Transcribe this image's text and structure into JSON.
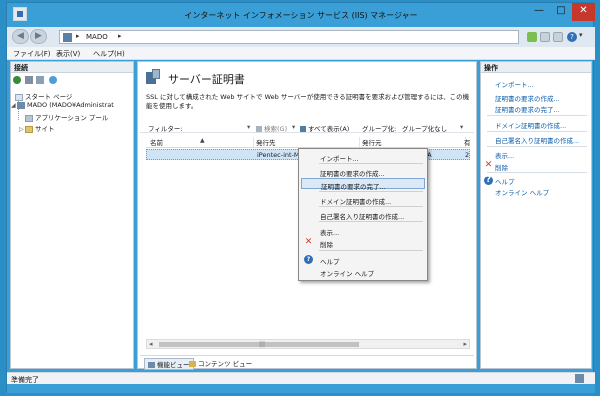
{
  "window": {
    "title": "インターネット インフォメーション サービス (IIS) マネージャー",
    "min_glyph": "—",
    "max_glyph": "□",
    "close_glyph": "✕"
  },
  "nav": {
    "back_glyph": "◀",
    "fwd_glyph": "▶",
    "sep1": "▸",
    "address_segment": "MADO",
    "sep2": "▸",
    "help_glyph": "?",
    "help_dropdown": "▾"
  },
  "menu": [
    "ファイル(F)",
    "表示(V)",
    "ヘルプ(H)"
  ],
  "connections": {
    "header": "接続",
    "tree": [
      {
        "label": "スタート ページ",
        "icon": "start-page-icon"
      },
      {
        "label": "MADO (MADO¥Administrat",
        "icon": "server-icon",
        "expander": "◢"
      },
      {
        "label": "アプリケーション プール",
        "icon": "app-pool-icon"
      },
      {
        "label": "サイト",
        "icon": "sites-icon",
        "expander": "▷"
      }
    ]
  },
  "main": {
    "title": "サーバー証明書",
    "description": "SSL に対して構成された Web サイトで Web サーバーが使用できる証明書を要求および管理するには、この機能を使用します。",
    "filter_label": "フィルター:",
    "filter_dropdown": "▾",
    "search_label": "検索(G)",
    "search_dropdown": "▾",
    "show_all_label": "すべて表示(A)",
    "group_label": "グループ化:",
    "group_value": "グループ化なし",
    "group_dropdown": "▾",
    "columns": [
      "名前",
      "発行先",
      "発行元",
      "有"
    ],
    "sort_glyph": "▲",
    "rows": [
      {
        "name": "",
        "issued_to": "iPentec-int-MADO-CA",
        "issued_by": "iPentec-int-MADO-CA",
        "expires": "2"
      }
    ],
    "scroll_left": "◂",
    "scroll_right": "▸",
    "scroll_grip": "|||",
    "tabs": [
      "機能ビュー",
      "コンテンツ ビュー"
    ]
  },
  "context_menu": {
    "items": [
      {
        "label": "インポート..."
      },
      {
        "label": "証明書の要求の作成..."
      },
      {
        "label": "証明書の要求の完了...",
        "highlighted": true
      },
      {
        "label": "ドメイン証明書の作成..."
      },
      {
        "label": "自己署名入り証明書の作成..."
      },
      {
        "label": "表示..."
      },
      {
        "label": "削除",
        "icon": "delete-icon",
        "glyph": "✕"
      },
      {
        "label": "ヘルプ",
        "icon": "help-icon",
        "glyph": "?"
      },
      {
        "label": "オンライン ヘルプ"
      }
    ]
  },
  "actions": {
    "header": "操作",
    "items": [
      {
        "label": "インポート..."
      },
      {
        "label": "証明書の要求の作成..."
      },
      {
        "label": "証明書の要求の完了..."
      },
      {
        "label": "ドメイン証明書の作成..."
      },
      {
        "label": "自己署名入り証明書の作成..."
      },
      {
        "label": "表示..."
      },
      {
        "label": "削除",
        "glyph": "✕"
      },
      {
        "label": "ヘルプ",
        "glyph": "?"
      },
      {
        "label": "オンライン ヘルプ"
      }
    ]
  },
  "status": {
    "text": "準備完了"
  },
  "colors": {
    "accent": "#3a9fd6",
    "highlight": "#dbe9f6",
    "link": "#0b5ea8",
    "delete": "#d23a2a"
  }
}
